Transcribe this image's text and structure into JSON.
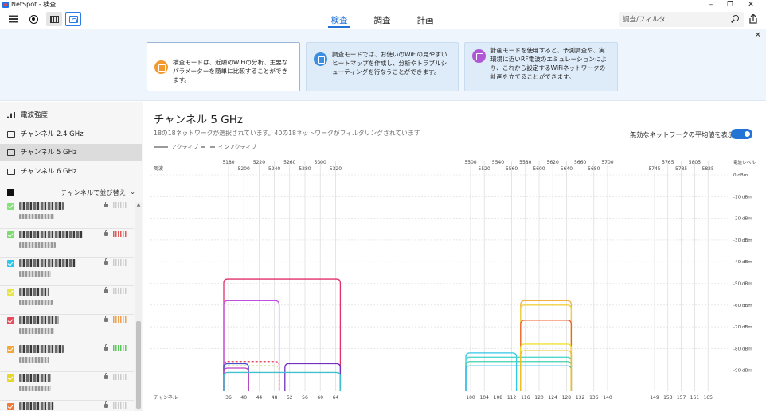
{
  "window": {
    "title": "NetSpot - 検査",
    "controls": {
      "minimize": "–",
      "restore": "❐",
      "close": "✕"
    }
  },
  "toolbar": {
    "tabs": [
      {
        "label": "検査",
        "active": true
      },
      {
        "label": "調査",
        "active": false
      },
      {
        "label": "計画",
        "active": false
      }
    ],
    "search_placeholder": "調査/フィルタ"
  },
  "banner": {
    "cards": [
      {
        "text": "検査モードは、近隣のWiFiの分析、主要なパラメーターを簡単に比較することができます。",
        "icon": "inspect-icon",
        "color": "#f29a2e"
      },
      {
        "text": "調査モードでは、お使いのWiFiの見やすいヒートマップを作成し、分析やトラブルシューティングを行なうことができます。",
        "icon": "survey-icon",
        "color": "#3b8fe0"
      },
      {
        "text": "計画モードを使用すると、予測調査や、実環境に近いRF電波のエミュレーションにより、これから設定するWiFiネットワークの計画を立てることができます。",
        "icon": "plan-icon",
        "color": "#b057d6"
      }
    ]
  },
  "sidebar": {
    "nav": [
      {
        "label": "電波強度",
        "active": false
      },
      {
        "label": "チャンネル 2.4 GHz",
        "active": false
      },
      {
        "label": "チャンネル 5 GHz",
        "active": true
      },
      {
        "label": "チャンネル 6 GHz",
        "active": false
      }
    ],
    "sort_label": "チャンネルで並び替え",
    "sort_chevron": "⌄",
    "networks": [
      {
        "color": "#86e07a",
        "signal_color": "#cccccc"
      },
      {
        "color": "#7ddc6e",
        "signal_color": "#e05a5a"
      },
      {
        "color": "#29c7ee",
        "signal_color": "#cccccc"
      },
      {
        "color": "#e6e64a",
        "signal_color": "#cccccc"
      },
      {
        "color": "#ea4a5c",
        "signal_color": "#f0a050"
      },
      {
        "color": "#f4a83a",
        "signal_color": "#5ac85a"
      },
      {
        "color": "#e8d62a",
        "signal_color": "#cccccc"
      },
      {
        "color": "#f07a3a",
        "signal_color": "#cccccc"
      }
    ]
  },
  "content": {
    "title": "チャンネル 5 GHz",
    "subtitle": "18の18ネットワークが選択されています。40の18ネットワークがフィルタリングされています",
    "legend_active": "アクティブ",
    "legend_inactive": "インアクティブ",
    "avg_toggle_label": "無効なネットワークの平均値を表示",
    "avg_toggle_on": true
  },
  "chart_data": {
    "type": "area",
    "x_axis_label": "チャンネル",
    "freq_axis_label": "周波",
    "y_axis_label": "電波レベル",
    "ylim": [
      -100,
      0
    ],
    "y_ticks": [
      0,
      -10,
      -20,
      -30,
      -40,
      -50,
      -60,
      -70,
      -80,
      -90
    ],
    "y_tick_labels": [
      "0 dBm",
      "-10 dBm",
      "-20 dBm",
      "-30 dBm",
      "-40 dBm",
      "-50 dBm",
      "-60 dBm",
      "-70 dBm",
      "-80 dBm",
      "-90 dBm"
    ],
    "channels": [
      36,
      40,
      44,
      48,
      52,
      56,
      60,
      64,
      100,
      104,
      108,
      112,
      116,
      120,
      124,
      128,
      132,
      136,
      140,
      149,
      153,
      157,
      161,
      165
    ],
    "freq_top": [
      "5180",
      "5220",
      "5260",
      "5300",
      "5500",
      "5540",
      "5580",
      "5620",
      "5660",
      "5700",
      "5765",
      "5805"
    ],
    "freq_bottom": [
      "5200",
      "5240",
      "5280",
      "5320",
      "5520",
      "5560",
      "5600",
      "5640",
      "5680",
      "5745",
      "5785",
      "5825"
    ],
    "series": [
      {
        "from": 36,
        "to": 64,
        "level": -48,
        "color": "#e0306a",
        "dashed": false
      },
      {
        "from": 36,
        "to": 48,
        "level": -58,
        "color": "#c050e0",
        "dashed": false
      },
      {
        "from": 36,
        "to": 48,
        "level": -86,
        "color": "#e03050",
        "dashed": true
      },
      {
        "from": 36,
        "to": 48,
        "level": -88,
        "color": "#a0d040",
        "dashed": true
      },
      {
        "from": 36,
        "to": 40,
        "level": -87,
        "color": "#4050d0",
        "dashed": false
      },
      {
        "from": 36,
        "to": 40,
        "level": -89,
        "color": "#c040c0",
        "dashed": false
      },
      {
        "from": 52,
        "to": 64,
        "level": -87,
        "color": "#7030c0",
        "dashed": false
      },
      {
        "from": 36,
        "to": 64,
        "level": -91,
        "color": "#40c0d0",
        "dashed": false
      },
      {
        "from": 100,
        "to": 112,
        "level": -82,
        "color": "#30c8e8",
        "dashed": false
      },
      {
        "from": 100,
        "to": 128,
        "level": -84,
        "color": "#50d8d0",
        "dashed": false
      },
      {
        "from": 100,
        "to": 128,
        "level": -86,
        "color": "#40d0b0",
        "dashed": false
      },
      {
        "from": 100,
        "to": 128,
        "level": -88,
        "color": "#30b8f0",
        "dashed": false
      },
      {
        "from": 116,
        "to": 128,
        "level": -58,
        "color": "#f0b040",
        "dashed": false
      },
      {
        "from": 116,
        "to": 128,
        "level": -60,
        "color": "#f0d040",
        "dashed": false
      },
      {
        "from": 116,
        "to": 128,
        "level": -67,
        "color": "#f06030",
        "dashed": false
      },
      {
        "from": 116,
        "to": 128,
        "level": -78,
        "color": "#f0e030",
        "dashed": false
      },
      {
        "from": 116,
        "to": 128,
        "level": -81,
        "color": "#e8c020",
        "dashed": false
      }
    ]
  }
}
